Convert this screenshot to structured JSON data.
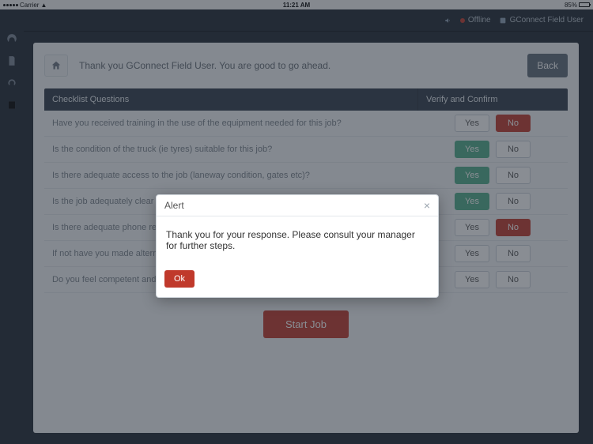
{
  "statusbar": {
    "carrier": "Carrier",
    "time": "11:21 AM",
    "battery": "85%"
  },
  "topbar": {
    "offline": "Offline",
    "user": "GConnect Field User"
  },
  "page": {
    "greeting": "Thank you GConnect Field User. You are good to go ahead.",
    "back": "Back",
    "col1": "Checklist Questions",
    "col2": "Verify and Confirm",
    "yes": "Yes",
    "no": "No",
    "start": "Start Job"
  },
  "questions": [
    {
      "q": "Have you received training in the use of the equipment needed for this job?",
      "sel": "no"
    },
    {
      "q": "Is the condition of the truck (ie tyres) suitable for this job?",
      "sel": "yes"
    },
    {
      "q": "Is there adequate access to the job (laneway condition, gates etc)?",
      "sel": "yes"
    },
    {
      "q": "Is the job adequately clear of overhead hazards?",
      "sel": "yes"
    },
    {
      "q": "Is there adequate phone reception at the job site?",
      "sel": "no"
    },
    {
      "q": "If not have you made alternative arrangements?",
      "sel": ""
    },
    {
      "q": "Do you feel competent and confident to do this job?",
      "sel": ""
    }
  ],
  "alert": {
    "title": "Alert",
    "message": "Thank you for your response. Please consult your manager for further steps.",
    "ok": "Ok"
  }
}
